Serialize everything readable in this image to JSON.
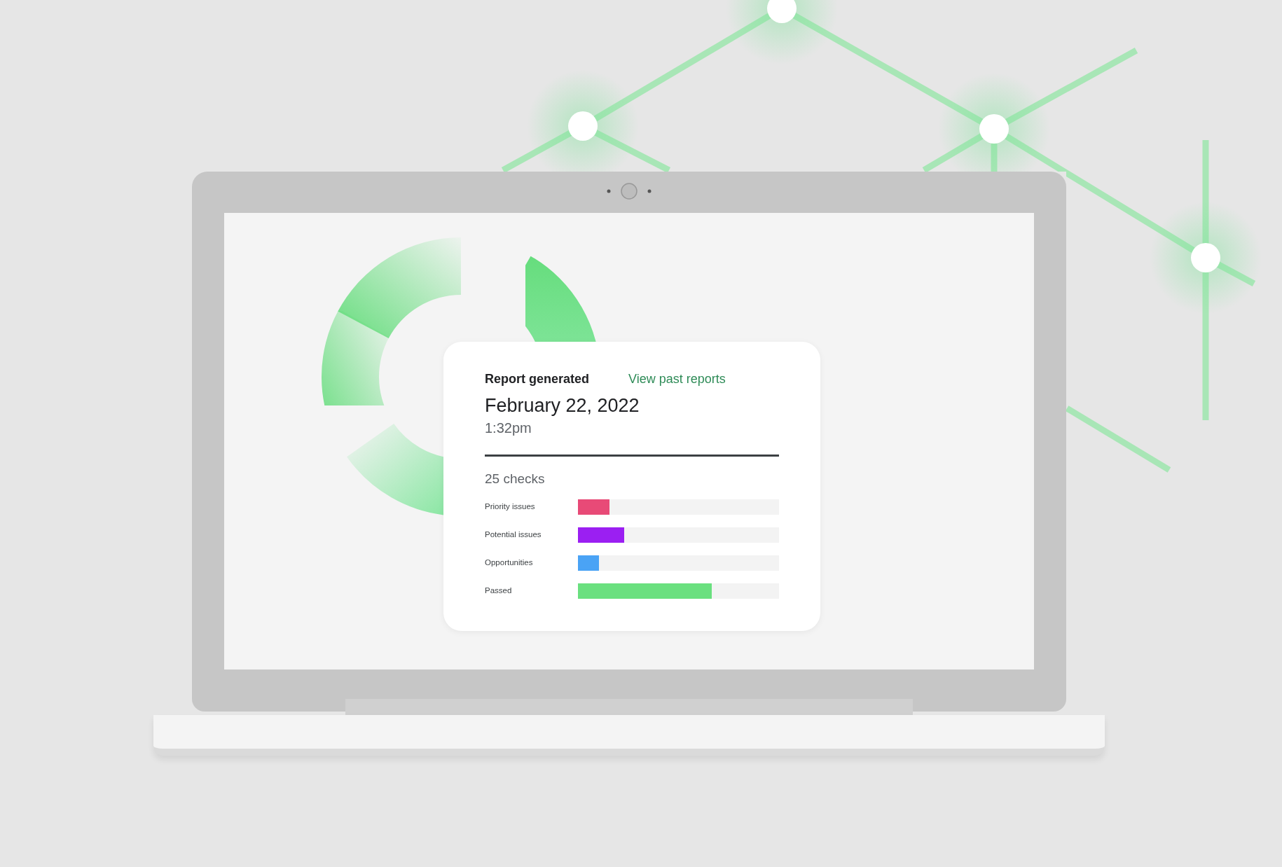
{
  "report": {
    "title": "Report generated",
    "link": "View past reports",
    "date": "February 22, 2022",
    "time": "1:32pm",
    "checks": "25 checks",
    "categories": [
      {
        "label": "Priority issues",
        "color": "#e84a77",
        "level": 0.156
      },
      {
        "label": "Potential issues",
        "color": "#9b1ff2",
        "level": 0.23
      },
      {
        "label": "Opportunities",
        "color": "#4aa3f5",
        "level": 0.105
      },
      {
        "label": "Passed",
        "color": "#6ae07f",
        "level": 0.665
      }
    ]
  }
}
